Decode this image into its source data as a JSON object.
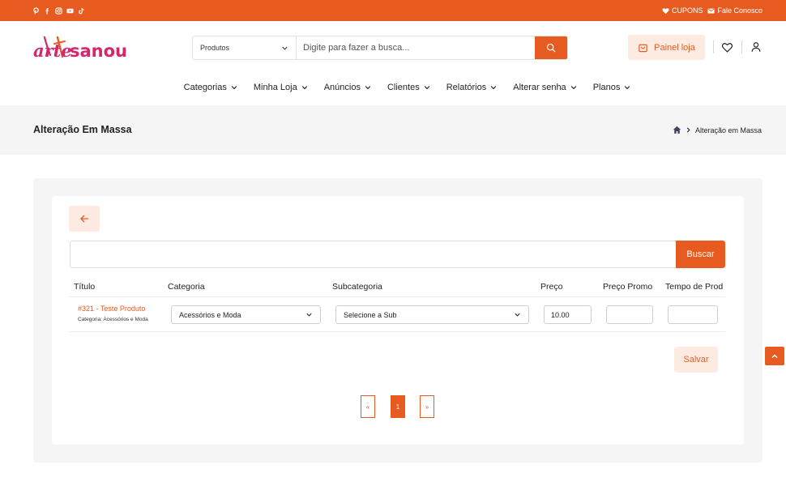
{
  "colors": {
    "accent": "#e85b20",
    "accent_light": "#fdebe2",
    "band": "#f5f5f6",
    "logo_pink": "#d4256e"
  },
  "topbar": {
    "social_icons": [
      "pinterest-icon",
      "facebook-icon",
      "instagram-icon",
      "youtube-icon",
      "tiktok-icon"
    ],
    "coupons_label": "CUPONS",
    "contact_label": "Fale Conosco"
  },
  "header": {
    "logo_text_1": "arte",
    "logo_text_2": "sanou",
    "search": {
      "category": "Produtos",
      "placeholder": "Digite para fazer a busca..."
    },
    "panel_label": "Painel loja"
  },
  "nav": {
    "items": [
      "Categorias",
      "Minha Loja",
      "Anúncios",
      "Clientes",
      "Relatórios",
      "Alterar senha",
      "Planos"
    ]
  },
  "page": {
    "title": "Alteração Em Massa",
    "breadcrumb_current": "Alteração em Massa"
  },
  "filter": {
    "value": "",
    "button_label": "Buscar"
  },
  "table": {
    "headers": [
      "Título",
      "Categoria",
      "Subcategoria",
      "Preço",
      "Preço Promo",
      "Tempo de Prod"
    ],
    "rows": [
      {
        "title": "#321 - Teste Produto",
        "category_note": "Categoria: Acessórios e Moda",
        "category": "Acessórios e Moda",
        "subcategory": "Selecione a Sub",
        "price": "10.00",
        "promo_price": "",
        "production_time": ""
      }
    ]
  },
  "save_label": "Salvar",
  "pagination": {
    "prev": "«",
    "current": "1",
    "next": "»"
  }
}
